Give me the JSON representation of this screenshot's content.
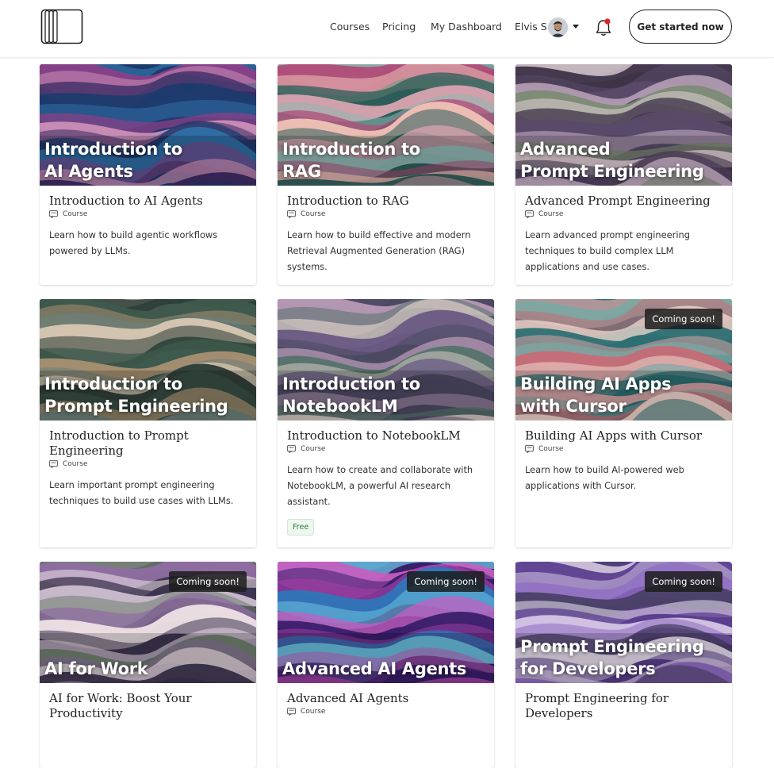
{
  "nav": {
    "links": [
      "Courses",
      "Pricing",
      "My Dashboard"
    ],
    "user_name": "Elvis S",
    "cta_label": "Get started now",
    "icons": [
      "logo-icon",
      "avatar",
      "chevron-down-icon",
      "bell-icon"
    ]
  },
  "course_type_label": "Course",
  "courses": [
    {
      "thumb_title": "Introduction to\nAI Agents",
      "title": "Introduction to AI Agents",
      "type": "Course",
      "description": "Learn how to build agentic workflows powered by LLMs.",
      "badge": "",
      "tag": ""
    },
    {
      "thumb_title": "Introduction to\nRAG",
      "title": "Introduction to RAG",
      "type": "Course",
      "description": "Learn how to build effective and modern Retrieval Augmented Generation (RAG) systems.",
      "badge": "",
      "tag": ""
    },
    {
      "thumb_title": "Advanced\nPrompt Engineering",
      "title": "Advanced Prompt Engineering",
      "type": "Course",
      "description": "Learn advanced prompt engineering techniques to build complex LLM applications and use cases.",
      "badge": "",
      "tag": ""
    },
    {
      "thumb_title": "Introduction to\nPrompt Engineering",
      "title": "Introduction to Prompt Engineering",
      "type": "Course",
      "description": "Learn important prompt engineering techniques to build use cases with LLMs.",
      "badge": "",
      "tag": ""
    },
    {
      "thumb_title": "Introduction to\nNotebookLM",
      "title": "Introduction to NotebookLM",
      "type": "Course",
      "description": "Learn how to create and collaborate with NotebookLM, a powerful AI research assistant.",
      "badge": "",
      "tag": "Free"
    },
    {
      "thumb_title": "Building AI Apps\nwith Cursor",
      "title": "Building AI Apps with Cursor",
      "type": "Course",
      "description": "Learn how to build AI-powered web applications with Cursor.",
      "badge": "Coming soon!",
      "tag": ""
    },
    {
      "thumb_title": "AI for Work",
      "title": "AI for Work: Boost Your Productivity",
      "type": "",
      "description": "",
      "badge": "Coming soon!",
      "tag": ""
    },
    {
      "thumb_title": "Advanced AI Agents",
      "title": "Advanced AI Agents",
      "type": "Course",
      "description": "",
      "badge": "Coming soon!",
      "tag": ""
    },
    {
      "thumb_title": "Prompt Engineering\nfor Developers",
      "title": "Prompt Engineering for Developers",
      "type": "",
      "description": "",
      "badge": "Coming soon!",
      "tag": ""
    }
  ],
  "palettes": [
    [
      "#1d3b6e",
      "#2f6fa6",
      "#8a3f87",
      "#c98fb6",
      "#3a2a63"
    ],
    [
      "#2d5d5a",
      "#d9a3b0",
      "#8fb7b3",
      "#b24c78",
      "#f0c2b6"
    ],
    [
      "#5a4a6a",
      "#c9b2c7",
      "#7c8b74",
      "#e0cfd6",
      "#3d3347"
    ],
    [
      "#3f5a4d",
      "#a89072",
      "#6c7f7a",
      "#d8c8b3",
      "#2a3a35"
    ],
    [
      "#4d4a63",
      "#b79ab6",
      "#55736c",
      "#d7c9c4",
      "#6a5a84"
    ],
    [
      "#2e6f73",
      "#d9a3a4",
      "#7da6a1",
      "#c66c77",
      "#f1d9cf"
    ],
    [
      "#3e3550",
      "#cdbfcf",
      "#6d7f6d",
      "#8f6ea2",
      "#efe3e6"
    ],
    [
      "#3a1f6b",
      "#9b3ea1",
      "#2f76b8",
      "#6cc3e0",
      "#c45fc0"
    ],
    [
      "#5b3f8f",
      "#d6c6e6",
      "#8f6cc4",
      "#4a4066",
      "#efe6f3"
    ]
  ]
}
